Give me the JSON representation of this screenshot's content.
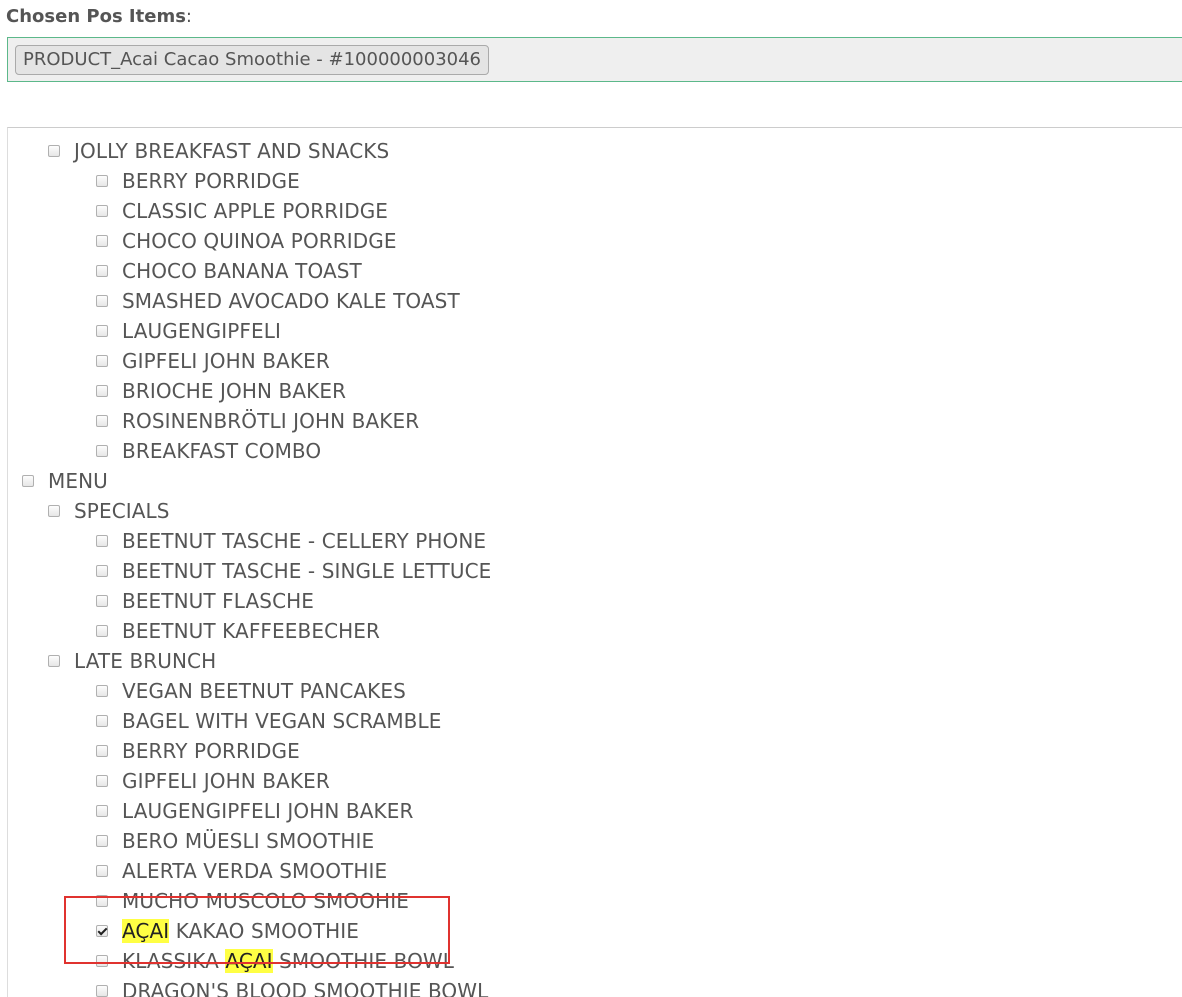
{
  "chosen": {
    "label": "Chosen Pos Items",
    "colon": ":",
    "chip": "PRODUCT_Acai Cacao Smoothie - #100000003046"
  },
  "tree": {
    "jolly": {
      "label": "JOLLY BREAKFAST AND SNACKS",
      "items": [
        "BERRY PORRIDGE",
        "CLASSIC APPLE PORRIDGE",
        "CHOCO QUINOA PORRIDGE",
        "CHOCO BANANA TOAST",
        "SMASHED AVOCADO KALE TOAST",
        "LAUGENGIPFELI",
        "GIPFELI JOHN BAKER",
        "BRIOCHE JOHN BAKER",
        "ROSINENBRÖTLI JOHN BAKER",
        "BREAKFAST COMBO"
      ]
    },
    "menu": {
      "label": "MENU",
      "specials": {
        "label": "SPECIALS",
        "items": [
          "BEETNUT TASCHE - CELLERY PHONE",
          "BEETNUT TASCHE - SINGLE LETTUCE",
          "BEETNUT FLASCHE",
          "BEETNUT KAFFEEBECHER"
        ]
      },
      "late_brunch": {
        "label": "LATE BRUNCH",
        "items": [
          "VEGAN BEETNUT PANCAKES",
          "BAGEL WITH VEGAN SCRAMBLE",
          "BERRY PORRIDGE",
          "GIPFELI JOHN BAKER",
          "LAUGENGIPFELI JOHN BAKER",
          "BERO MÜESLI SMOOTHIE",
          "ALERTA VERDA SMOOTHIE",
          "MUCHO MUSCOLO SMOOHIE"
        ],
        "acai_item": {
          "hl": "AÇAI",
          "rest": " KAKAO SMOOTHIE",
          "checked": true
        },
        "klassika_item": {
          "pre": "KLASSIKA ",
          "hl": "AÇAI",
          "post": " SMOOTHIE BOWL"
        },
        "dragon_item": "DRAGON'S BLOOD SMOOTHIE BOWL"
      }
    }
  },
  "colors": {
    "highlight": "#ffff44",
    "callout": "#e0322f",
    "focus_border": "#5cb88a"
  }
}
